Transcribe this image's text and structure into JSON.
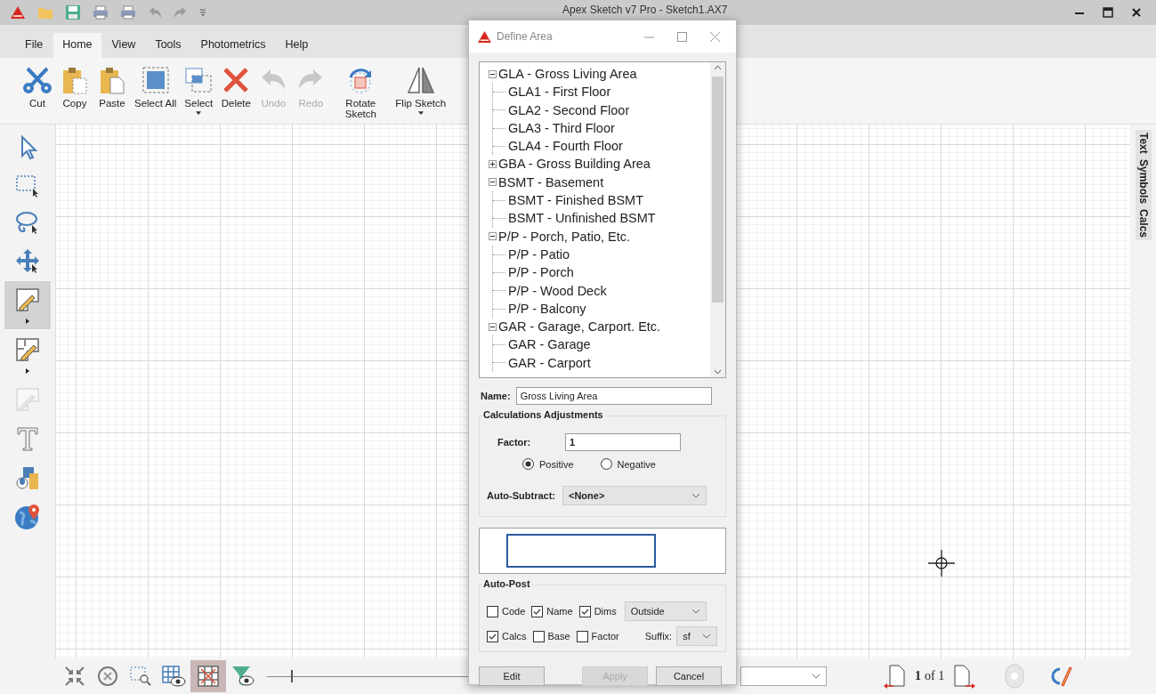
{
  "app": {
    "title": "Apex Sketch v7 Pro - Sketch1.AX7"
  },
  "quick_access": [
    {
      "kind": "folder",
      "disabled": false
    },
    {
      "kind": "save",
      "disabled": false
    },
    {
      "kind": "print",
      "disabled": false
    },
    {
      "kind": "print",
      "disabled": false
    },
    {
      "kind": "undo",
      "disabled": true
    },
    {
      "kind": "redo",
      "disabled": true
    },
    {
      "kind": "customize",
      "disabled": false
    }
  ],
  "menu_tabs": [
    {
      "label": "File",
      "selected": false
    },
    {
      "label": "Home",
      "selected": true
    },
    {
      "label": "View",
      "selected": false
    },
    {
      "label": "Tools",
      "selected": false
    },
    {
      "label": "Photometrics",
      "selected": false
    },
    {
      "label": "Help",
      "selected": false
    }
  ],
  "ribbon": [
    {
      "label": "Cut",
      "kind": "cut",
      "disabled": false,
      "dropdown": false
    },
    {
      "label": "Copy",
      "kind": "copy",
      "disabled": false,
      "dropdown": false
    },
    {
      "label": "Paste",
      "kind": "paste",
      "disabled": false,
      "dropdown": false
    },
    {
      "label": "Select All",
      "kind": "select_all",
      "disabled": false,
      "dropdown": false
    },
    {
      "label": "Select",
      "kind": "select",
      "disabled": false,
      "dropdown": true
    },
    {
      "label": "Delete",
      "kind": "delete",
      "disabled": false,
      "dropdown": false
    },
    {
      "label": "Undo",
      "kind": "undo",
      "disabled": true,
      "dropdown": false
    },
    {
      "label": "Redo",
      "kind": "redo",
      "disabled": true,
      "dropdown": false
    },
    {
      "label": "Rotate Sketch",
      "kind": "rotate",
      "disabled": false,
      "dropdown": false
    },
    {
      "label": "Flip Sketch",
      "kind": "flip",
      "disabled": false,
      "dropdown": true
    }
  ],
  "tools": [
    {
      "kind": "pointer",
      "selected": false,
      "dropdown": false,
      "disabled": false
    },
    {
      "kind": "marquee",
      "selected": false,
      "dropdown": false,
      "disabled": false
    },
    {
      "kind": "lasso",
      "selected": false,
      "dropdown": false,
      "disabled": false
    },
    {
      "kind": "move",
      "selected": false,
      "dropdown": false,
      "disabled": false
    },
    {
      "kind": "draw_area",
      "selected": true,
      "dropdown": true,
      "disabled": false
    },
    {
      "kind": "draw_room",
      "selected": false,
      "dropdown": true,
      "disabled": false
    },
    {
      "kind": "draw_area",
      "selected": false,
      "dropdown": false,
      "disabled": true
    },
    {
      "kind": "text",
      "selected": false,
      "dropdown": false,
      "disabled": false
    },
    {
      "kind": "symbols",
      "selected": false,
      "dropdown": false,
      "disabled": false
    },
    {
      "kind": "globe",
      "selected": false,
      "dropdown": false,
      "disabled": false
    }
  ],
  "side_tabs": [
    {
      "label": "Text"
    },
    {
      "label": "Symbols"
    },
    {
      "label": "Calcs"
    }
  ],
  "bottom_bar": {
    "tools": [
      {
        "kind": "shrink",
        "selected": false
      },
      {
        "kind": "zoom_fit",
        "selected": false
      },
      {
        "kind": "zoom_window",
        "selected": false
      },
      {
        "kind": "grid_view",
        "selected": false
      },
      {
        "kind": "grid",
        "selected": true
      },
      {
        "kind": "filter",
        "selected": false
      }
    ],
    "zoom": {
      "level": 0.08
    },
    "page_current": "1",
    "page_total": "of 1"
  },
  "dialog": {
    "title": "Define Area",
    "tree": [
      {
        "label": "GLA - Gross Living Area",
        "expanded": true,
        "children": [
          {
            "label": "GLA1 - First Floor"
          },
          {
            "label": "GLA2 - Second Floor"
          },
          {
            "label": "GLA3 - Third Floor"
          },
          {
            "label": "GLA4 - Fourth Floor"
          }
        ]
      },
      {
        "label": "GBA - Gross Building Area",
        "expanded": false
      },
      {
        "label": "BSMT - Basement",
        "expanded": true,
        "children": [
          {
            "label": "BSMT - Finished BSMT"
          },
          {
            "label": "BSMT - Unfinished BSMT"
          }
        ]
      },
      {
        "label": "P/P - Porch, Patio, Etc.",
        "expanded": true,
        "children": [
          {
            "label": "P/P - Patio"
          },
          {
            "label": "P/P - Porch"
          },
          {
            "label": "P/P - Wood Deck"
          },
          {
            "label": "P/P - Balcony"
          }
        ]
      },
      {
        "label": "GAR - Garage, Carport. Etc.",
        "expanded": true,
        "children": [
          {
            "label": "GAR - Garage"
          },
          {
            "label": "GAR - Carport"
          }
        ]
      }
    ],
    "name_label": "Name:",
    "name_value": "Gross Living Area",
    "calculations": {
      "title": "Calculations Adjustments",
      "factor_label": "Factor:",
      "factor_value": "1",
      "signs": [
        {
          "label": "Positive",
          "selected": true
        },
        {
          "label": "Negative",
          "selected": false
        }
      ],
      "auto_subtract_label": "Auto-Subtract:",
      "auto_subtract_value": "<None>"
    },
    "auto_post": {
      "title": "Auto-Post",
      "options": [
        {
          "label": "Code",
          "checked": false
        },
        {
          "label": "Name",
          "checked": true
        },
        {
          "label": "Dims",
          "checked": true
        },
        {
          "label": "Calcs",
          "checked": true
        },
        {
          "label": "Base",
          "checked": false
        },
        {
          "label": "Factor",
          "checked": false
        }
      ],
      "dims_value": "Outside",
      "suffix_label": "Suffix:",
      "suffix_value": "sf"
    },
    "buttons": [
      {
        "label": "Edit",
        "disabled": false
      },
      {
        "label": "Apply",
        "disabled": true
      },
      {
        "label": "Cancel",
        "disabled": false
      }
    ]
  }
}
